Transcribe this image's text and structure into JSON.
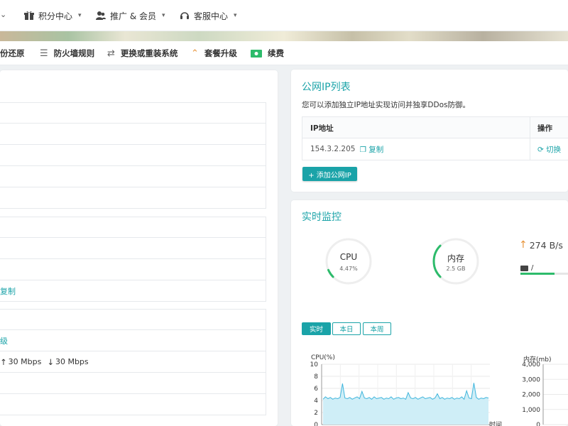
{
  "topnav": {
    "items": [
      {
        "label": "积分中心",
        "icon": "gift-icon"
      },
      {
        "label": "推广 & 会员",
        "icon": "users-icon"
      },
      {
        "label": "客服中心",
        "icon": "headset-icon"
      }
    ]
  },
  "toolbar": {
    "items": [
      {
        "label": "份还原",
        "icon": "restore-icon"
      },
      {
        "label": "防火墙规则",
        "icon": "list-icon"
      },
      {
        "label": "更换或重装系统",
        "icon": "swap-icon"
      },
      {
        "label": "套餐升级",
        "icon": "upgrade-icon"
      },
      {
        "label": "续费",
        "icon": "money-icon"
      }
    ]
  },
  "left": {
    "copy_label": "复制",
    "level_frag": "级",
    "bw_up": "30 Mbps",
    "bw_down": "30 Mbps"
  },
  "ip_list": {
    "title": "公网IP列表",
    "desc": "您可以添加独立IP地址实现访问并独享DDos防御。",
    "col_ip": "IP地址",
    "col_op": "操作",
    "rows": [
      {
        "ip": "154.3.2.205",
        "copy": "复制",
        "action": "切换"
      }
    ],
    "add_button": "+ 添加公网IP"
  },
  "monitor": {
    "title": "实时监控",
    "cpu_label": "CPU",
    "cpu_value": "4.47%",
    "cpu_percent": 4.47,
    "mem_label": "内存",
    "mem_value": "2.5 GB",
    "mem_percent": 25,
    "net_speed": "274 B/s",
    "disk_label": "/",
    "tabs": [
      "实时",
      "本日",
      "本周"
    ],
    "active_tab": "实时"
  },
  "colors": {
    "accent": "#1aa3a8",
    "green": "#2dbb6b",
    "orange": "#e8943a"
  },
  "chart_data": [
    {
      "type": "area",
      "title": "CPU(%)",
      "xlabel": "时间",
      "ylim": [
        0,
        10
      ],
      "yticks": [
        "10",
        "8",
        "6",
        "4",
        "2",
        "0"
      ],
      "values": [
        4.2,
        4.6,
        4.3,
        4.5,
        4.2,
        4.4,
        4.3,
        4.5,
        6.8,
        4.4,
        4.3,
        4.5,
        4.2,
        4.4,
        4.6,
        4.3,
        5.5,
        4.4,
        4.3,
        4.5,
        4.2,
        4.6,
        4.3,
        4.4,
        4.5,
        4.2,
        4.4,
        4.3,
        4.6,
        4.2,
        4.4,
        4.5,
        4.3,
        4.4,
        4.2,
        5.3,
        4.4,
        4.3,
        4.5,
        4.2,
        4.4,
        4.6,
        4.3,
        4.4,
        4.5,
        4.2,
        4.4,
        5.1,
        4.3,
        4.5,
        4.2,
        4.4,
        4.3,
        4.5,
        4.2,
        4.4,
        4.3,
        4.6,
        4.2,
        5.6,
        4.4,
        4.3,
        6.9,
        4.5,
        4.2,
        4.4,
        4.3,
        4.5,
        4.4
      ]
    },
    {
      "type": "area",
      "title": "内存(mb)",
      "xlabel": "",
      "ylim": [
        0,
        4000
      ],
      "yticks": [
        "4,000",
        "3,000",
        "2,000",
        "1,000",
        "0"
      ]
    }
  ]
}
